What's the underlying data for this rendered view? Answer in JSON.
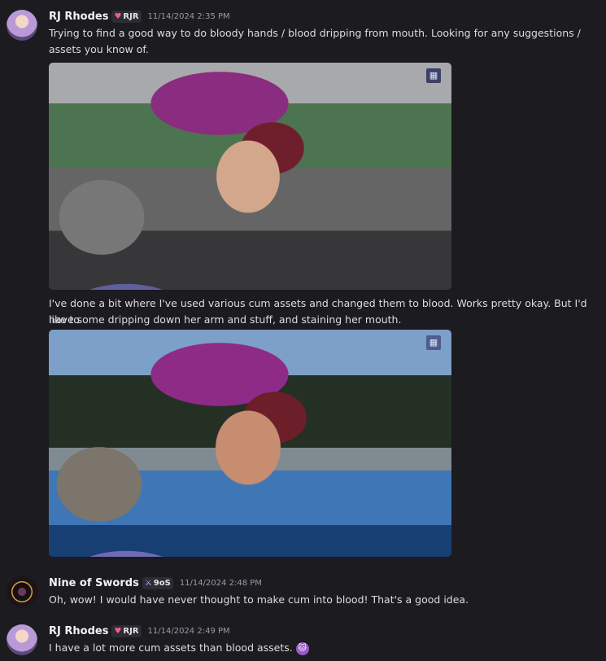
{
  "messages": [
    {
      "author": "RJ Rhodes",
      "tag": "RJR",
      "tag_icon": "heart-icon",
      "timestamp": "11/14/2024 2:35 PM",
      "lines": [
        "Trying to find a good way to do bloody hands / blood dripping from mouth. Looking for any suggestions /",
        "assets you know of.",
        "I've done a bit where I've used various cum assets and changed them to blood. Works pretty okay. But I'd like to",
        "have some dripping down her arm and stuff, and staining her mouth."
      ]
    },
    {
      "author": "Nine of Swords",
      "tag": "9oS",
      "tag_icon": "sword-icon",
      "timestamp": "11/14/2024 2:48 PM",
      "lines": [
        "Oh, wow! I would have never thought to make cum into blood! That's a good idea."
      ]
    },
    {
      "author": "RJ Rhodes",
      "tag": "RJR",
      "tag_icon": "heart-icon",
      "timestamp": "11/14/2024 2:49 PM",
      "lines": [
        "I have a lot more cum assets than blood assets."
      ],
      "emoji": "purple-cat-emoji-icon"
    }
  ],
  "colors": {
    "background": "#1b1b20",
    "author_name": "#f2f3f5",
    "body_text": "#dcdde1",
    "timestamp": "#9a9ca3",
    "heart": "#ef5d8d",
    "sword": "#c9a0ff"
  }
}
